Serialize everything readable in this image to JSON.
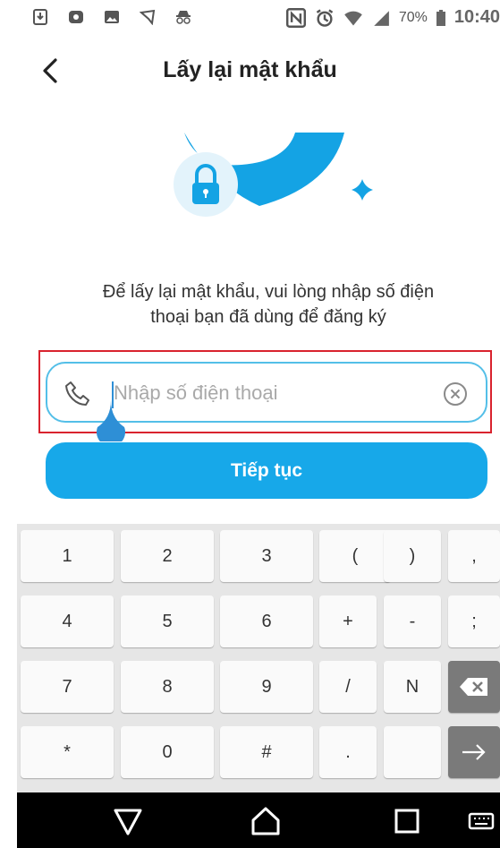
{
  "status_bar": {
    "battery_percent": "70%",
    "time": "10:40"
  },
  "header": {
    "title": "Lấy lại mật khẩu"
  },
  "description": {
    "line1": "Để lấy lại mật khẩu, vui lòng nhập số điện",
    "line2": "thoại bạn đã dùng để đăng ký"
  },
  "phone_field": {
    "value": "",
    "placeholder": "Nhập số điện thoại"
  },
  "continue_button": {
    "label": "Tiếp tục"
  },
  "keyboard": {
    "rows": [
      [
        "1",
        "2",
        "3",
        "(",
        ")",
        ","
      ],
      [
        "4",
        "5",
        "6",
        "+",
        "-",
        ";"
      ],
      [
        "7",
        "8",
        "9",
        "/",
        "N",
        ""
      ],
      [
        "*",
        "0",
        "#",
        ".",
        "",
        ""
      ]
    ]
  },
  "colors": {
    "accent": "#17a8e9",
    "field_border": "#54bfe8",
    "highlight": "#d9232e"
  }
}
